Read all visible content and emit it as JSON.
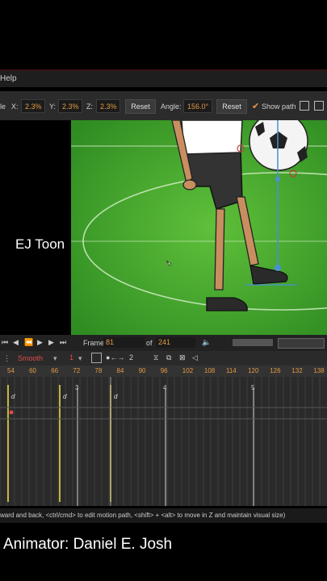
{
  "menu": {
    "help_label": "Help"
  },
  "toolbar": {
    "scale_label_fragment": "le",
    "x_label": "X:",
    "x_value": "2.3%",
    "y_label": "Y:",
    "y_value": "2.3%",
    "z_label": "Z:",
    "z_value": "2.3%",
    "reset_label": "Reset",
    "angle_label": "Angle:",
    "angle_value": "156.0°",
    "reset2_label": "Reset",
    "show_path_label": "Show path"
  },
  "overlay": {
    "title": "EJ Toon",
    "credit": "Animator: Daniel E. Josh"
  },
  "playback": {
    "frame_label": "Frame",
    "frame_value": "81",
    "of_label": "of",
    "total_frames": "241"
  },
  "curve": {
    "interpolation": "Smooth",
    "channel_value": "1",
    "keyframe_step": "2"
  },
  "ruler": {
    "ticks": [
      "54",
      "60",
      "66",
      "72",
      "78",
      "84",
      "90",
      "96",
      "102",
      "108",
      "114",
      "120",
      "126",
      "132",
      "138"
    ]
  },
  "timeline": {
    "sections": [
      "3",
      "4",
      "5"
    ],
    "key_label": "d"
  },
  "status": {
    "text": "ward and back, <ctrl/cmd> to edit motion path, <shift> + <alt> to move in Z and maintain visual size)"
  },
  "colors": {
    "accent": "#e59a45",
    "field_green": "#3a9d2a",
    "keyframe_yellow": "#f4e04a"
  }
}
